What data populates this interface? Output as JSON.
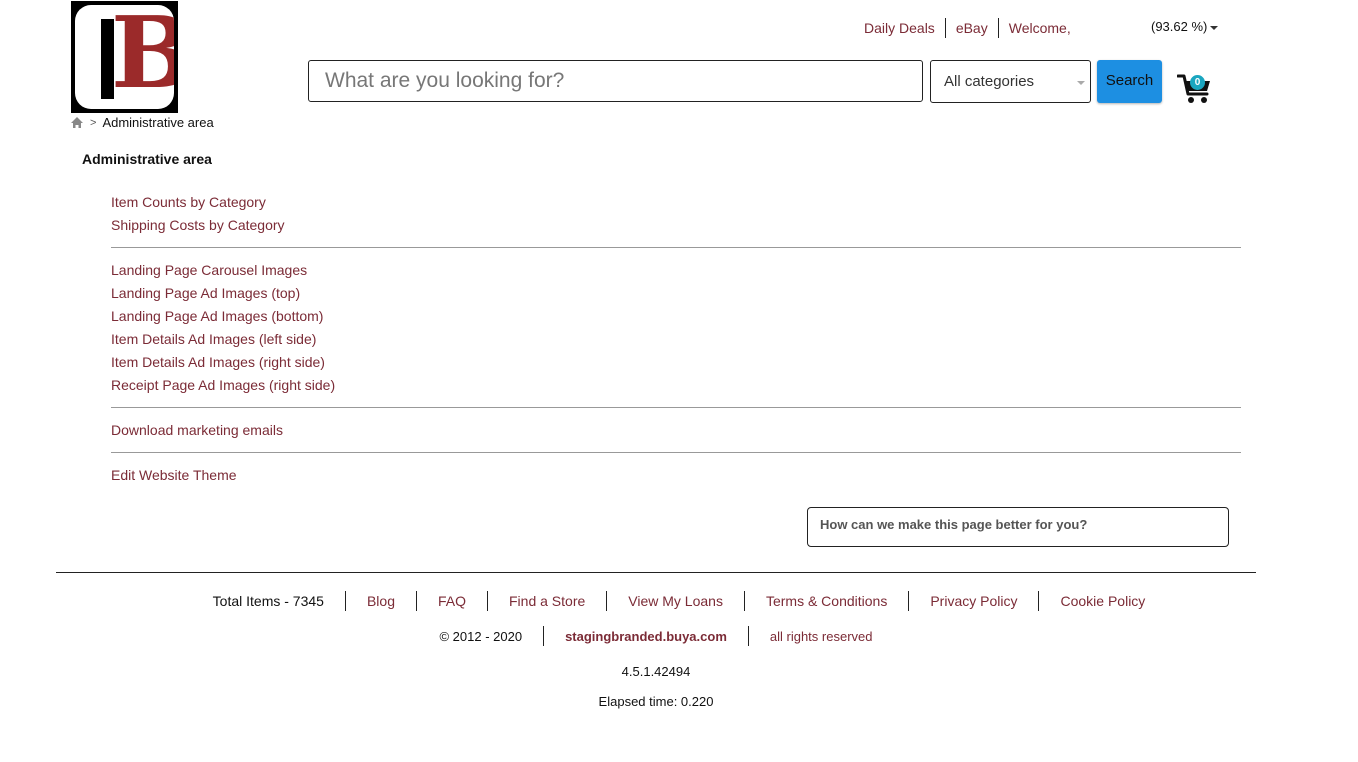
{
  "header": {
    "logo_letter": "B",
    "nav": [
      "Daily Deals",
      "eBay",
      "Welcome,"
    ],
    "percentage": "(93.62 %)"
  },
  "search": {
    "placeholder": "What are you looking for?",
    "category": "All categories",
    "button_label": "Search"
  },
  "cart": {
    "count": "0"
  },
  "breadcrumb": {
    "current": "Administrative area",
    "separator": ">"
  },
  "page": {
    "title": "Administrative area",
    "group1": [
      "Item Counts by Category",
      "Shipping Costs by Category"
    ],
    "group2": [
      "Landing Page Carousel Images",
      "Landing Page Ad Images (top)",
      "Landing Page Ad Images (bottom)",
      "Item Details Ad Images (left side)",
      "Item Details Ad Images (right side)",
      "Receipt Page Ad Images (right side)"
    ],
    "group3": [
      "Download marketing emails"
    ],
    "group4": [
      "Edit Website Theme"
    ]
  },
  "feedback": {
    "label": "How can we make this page better for you?"
  },
  "footer": {
    "total_items": "Total Items - 7345",
    "links": [
      "Blog",
      "FAQ",
      "Find a Store",
      "View My Loans",
      "Terms & Conditions",
      "Privacy Policy",
      "Cookie Policy"
    ],
    "copyright": "© 2012 - 2020",
    "domain": "stagingbranded.buya.com",
    "rights": "all rights reserved",
    "version": "4.5.1.42494",
    "elapsed": "Elapsed time: 0.220"
  },
  "colors": {
    "link": "#7b2b36",
    "search_button": "#1d8fe2",
    "logo_red": "#9b2a2a",
    "cart_badge": "#1aa6c0"
  }
}
